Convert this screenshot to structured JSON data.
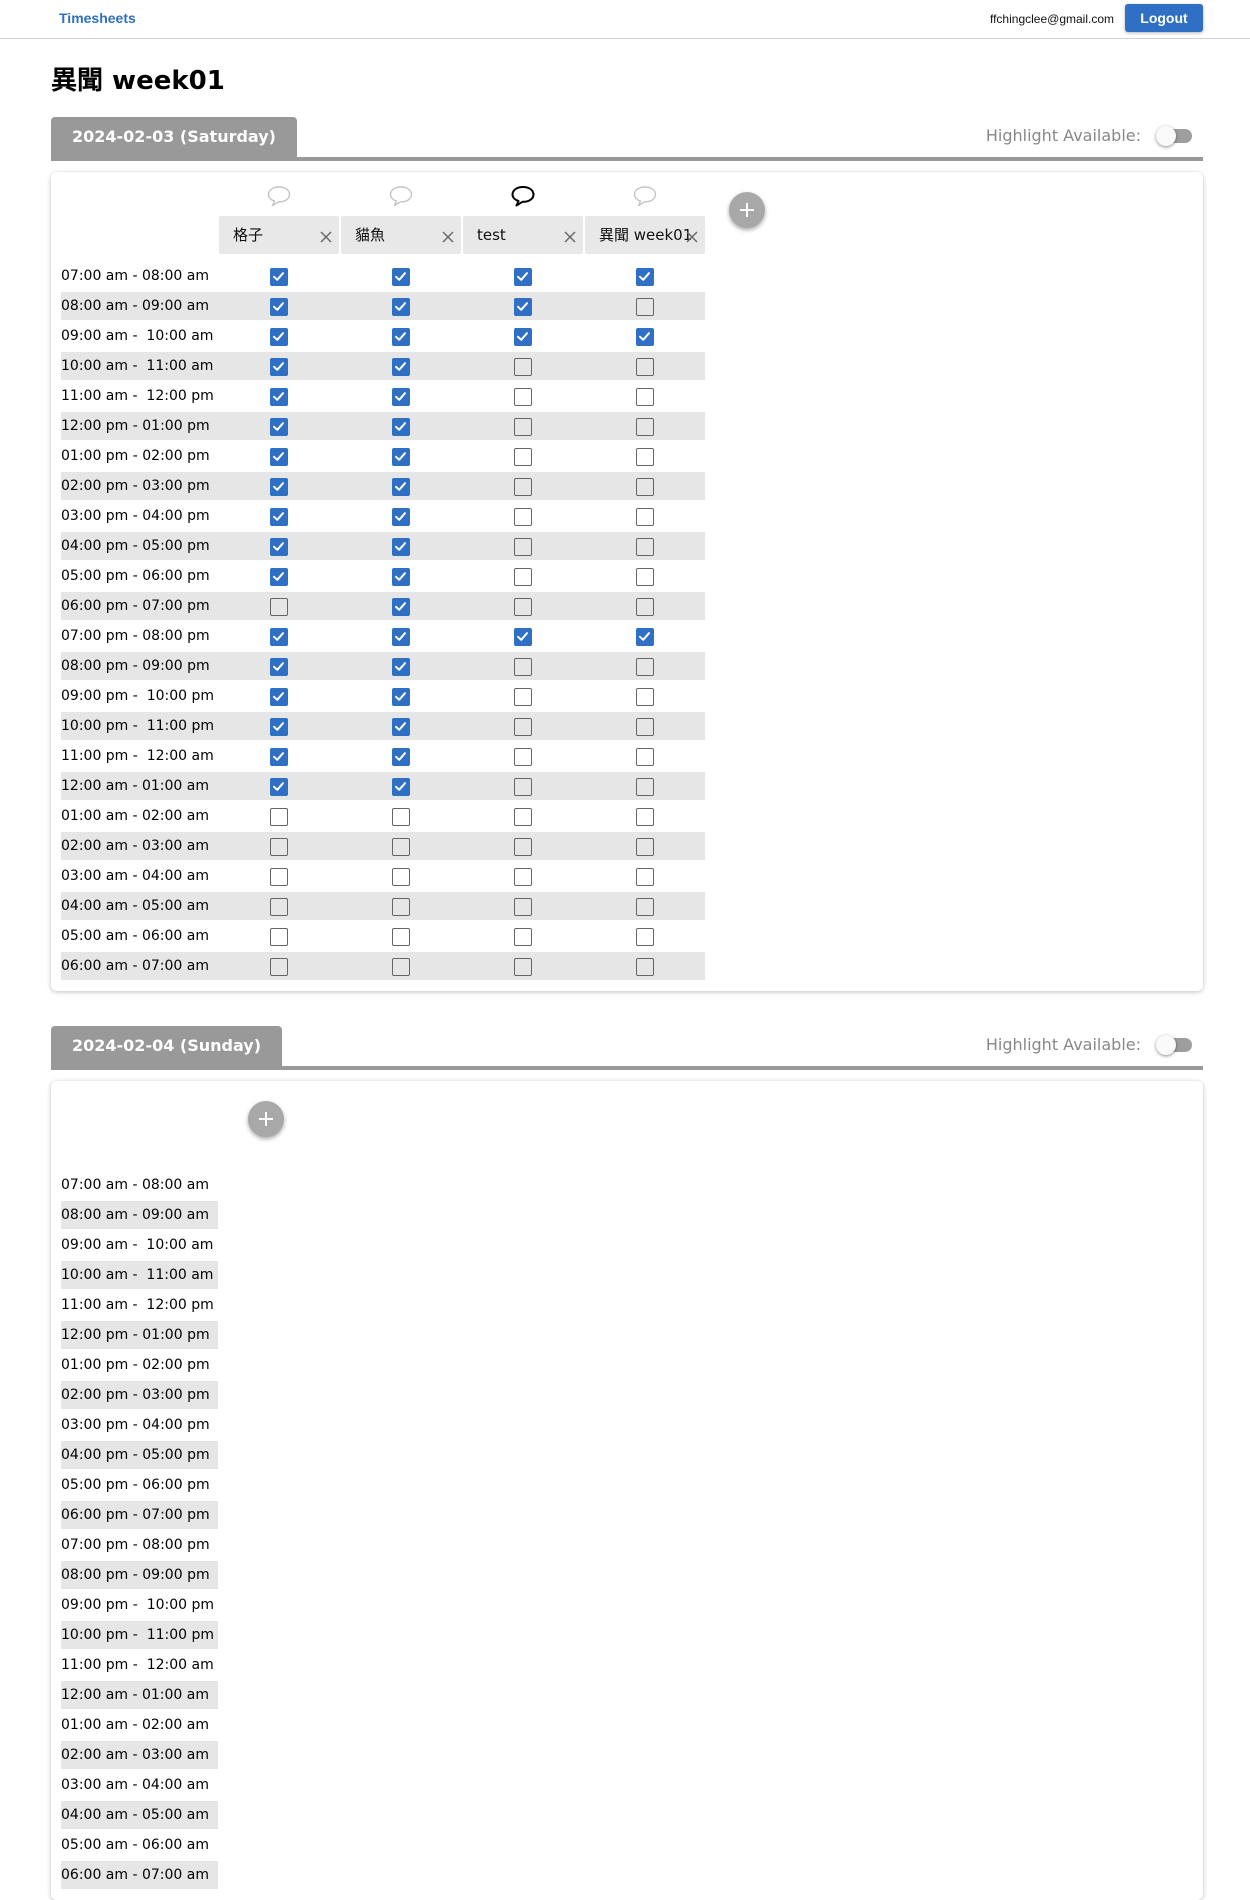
{
  "nav": {
    "brand": "Timesheets",
    "email": "ffchingclee@gmail.com",
    "logout_label": "Logout"
  },
  "page_title": "異聞 week01",
  "highlight_label": "Highlight Available:",
  "time_slots": [
    "07:00 am - 08:00 am",
    "08:00 am - 09:00 am",
    "09:00 am -  10:00 am",
    "10:00 am -  11:00 am",
    "11:00 am -  12:00 pm",
    "12:00 pm - 01:00 pm",
    "01:00 pm - 02:00 pm",
    "02:00 pm - 03:00 pm",
    "03:00 pm - 04:00 pm",
    "04:00 pm - 05:00 pm",
    "05:00 pm - 06:00 pm",
    "06:00 pm - 07:00 pm",
    "07:00 pm - 08:00 pm",
    "08:00 pm - 09:00 pm",
    "09:00 pm -  10:00 pm",
    "10:00 pm -  11:00 pm",
    "11:00 pm -  12:00 am",
    "12:00 am - 01:00 am",
    "01:00 am - 02:00 am",
    "02:00 am - 03:00 am",
    "03:00 am - 04:00 am",
    "04:00 am - 05:00 am",
    "05:00 am - 06:00 am",
    "06:00 am - 07:00 am"
  ],
  "days": [
    {
      "label": "2024-02-03 (Saturday)",
      "highlight_on": false,
      "people": [
        {
          "name": "格子",
          "comment_active": false,
          "availability": [
            1,
            1,
            1,
            1,
            1,
            1,
            1,
            1,
            1,
            1,
            1,
            0,
            1,
            1,
            1,
            1,
            1,
            1,
            0,
            0,
            0,
            0,
            0,
            0
          ]
        },
        {
          "name": "貓魚",
          "comment_active": false,
          "availability": [
            1,
            1,
            1,
            1,
            1,
            1,
            1,
            1,
            1,
            1,
            1,
            1,
            1,
            1,
            1,
            1,
            1,
            1,
            0,
            0,
            0,
            0,
            0,
            0
          ]
        },
        {
          "name": "test",
          "comment_active": true,
          "availability": [
            1,
            1,
            1,
            0,
            0,
            0,
            0,
            0,
            0,
            0,
            0,
            0,
            1,
            0,
            0,
            0,
            0,
            0,
            0,
            0,
            0,
            0,
            0,
            0
          ]
        },
        {
          "name": "異聞 week01",
          "comment_active": false,
          "availability": [
            1,
            0,
            1,
            0,
            0,
            0,
            0,
            0,
            0,
            0,
            0,
            0,
            1,
            0,
            0,
            0,
            0,
            0,
            0,
            0,
            0,
            0,
            0,
            0
          ]
        }
      ]
    },
    {
      "label": "2024-02-04 (Sunday)",
      "highlight_on": false,
      "people": []
    }
  ],
  "icons": {
    "comment": "speech-bubble-icon",
    "remove": "close-icon",
    "add": "plus-icon",
    "check": "checkmark-icon"
  },
  "colors": {
    "accent": "#2f6fc4",
    "tab": "#999999",
    "row_band": "#e6e6e6",
    "header_cell": "#e8e8e8"
  }
}
